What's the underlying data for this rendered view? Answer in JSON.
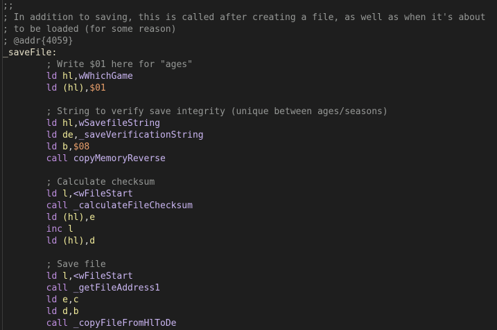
{
  "colors": {
    "background": "#1e1e1e",
    "comment": "#969896",
    "label": "#e6e0c8",
    "instruction": "#bf8fe0",
    "register": "#f0ea9a",
    "number": "#e89f6b",
    "symbol": "#c9b5f0"
  },
  "code": {
    "l0": {
      "comment": ";;"
    },
    "l1": {
      "comment": "; In addition to saving, this is called after creating a file, as well as when it's about"
    },
    "l2": {
      "comment": "; to be loaded (for some reason)"
    },
    "l3": {
      "comment": "; @addr{4059}"
    },
    "l4": {
      "label": "_saveFile:"
    },
    "l5": {
      "comment": "; Write $01 here for \"ages\""
    },
    "l6": {
      "op": "ld",
      "reg": "hl",
      "comma": ",",
      "arg": "wWhichGame"
    },
    "l7": {
      "op": "ld",
      "reg": "(hl)",
      "comma": ",",
      "num": "$01"
    },
    "l8": {
      "comment": "; String to verify save integrity (unique between ages/seasons)"
    },
    "l9": {
      "op": "ld",
      "reg": "hl",
      "comma": ",",
      "arg": "wSavefileString"
    },
    "l10": {
      "op": "ld",
      "reg": "de",
      "comma": ",",
      "arg": "_saveVerificationString"
    },
    "l11": {
      "op": "ld",
      "reg": "b",
      "comma": ",",
      "num": "$08"
    },
    "l12": {
      "op": "call",
      "arg": "copyMemoryReverse"
    },
    "l13": {
      "comment": "; Calculate checksum"
    },
    "l14": {
      "op": "ld",
      "reg": "l",
      "comma": ",",
      "arg": "<wFileStart"
    },
    "l15": {
      "op": "call",
      "arg": "_calculateFileChecksum"
    },
    "l16": {
      "op": "ld",
      "reg": "(hl)",
      "comma": ",",
      "reg2": "e"
    },
    "l17": {
      "op": "inc",
      "reg": "l"
    },
    "l18": {
      "op": "ld",
      "reg": "(hl)",
      "comma": ",",
      "reg2": "d"
    },
    "l19": {
      "comment": "; Save file"
    },
    "l20": {
      "op": "ld",
      "reg": "l",
      "comma": ",",
      "arg": "<wFileStart"
    },
    "l21": {
      "op": "call",
      "arg": "_getFileAddress1"
    },
    "l22": {
      "op": "ld",
      "reg": "e",
      "comma": ",",
      "reg2": "c"
    },
    "l23": {
      "op": "ld",
      "reg": "d",
      "comma": ",",
      "reg2": "b"
    },
    "l24": {
      "op": "call",
      "arg": "_copyFileFromHlToDe"
    }
  }
}
